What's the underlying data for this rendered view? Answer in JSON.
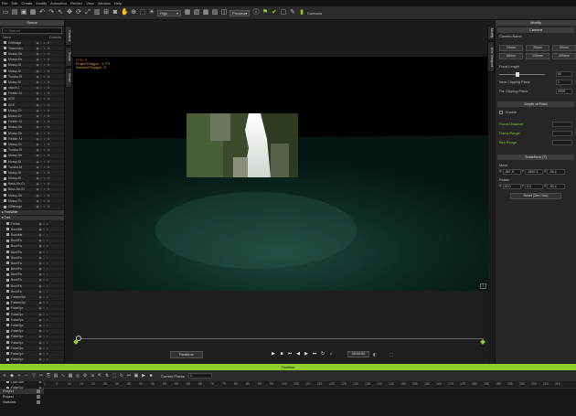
{
  "menu": [
    "File",
    "Edit",
    "Create",
    "Modify",
    "Animation",
    "Render",
    "View",
    "Window",
    "Help"
  ],
  "toolbar": {
    "quality": "High",
    "preview": "Preview",
    "contours": "Contours"
  },
  "scene": {
    "title": "Scene",
    "search_placeholder": "Search",
    "col_name": "Name",
    "col_controls": "Controls",
    "objects": [
      "Cliffmage",
      "Towermsh",
      "Mossy-Str",
      "Mossy-Str",
      "Mossy-St",
      "Mossy-St",
      "Tundra-St",
      "Mossy-St",
      "vaccin 1",
      "Fieldbr-St",
      "AGE",
      "AGE",
      "Mossy-Gr",
      "Mossy-Gr",
      "Fieldbr-St",
      "Mossy-Str",
      "Mossy-Str",
      "Fieldbr-St",
      "Mossy-Gr",
      "Tundra-St",
      "Mossy-Str",
      "Mossy-St",
      "Tundra-St",
      "Mossy-St",
      "Mossy-St",
      "Bass-Str-Gr",
      "Bass-Str-Gr",
      "Mossy-Str",
      "Mossy-Gr",
      "Cliffimage"
    ],
    "group1": "PostWrite",
    "group2": "Tree",
    "tree_items": [
      "Fieldw",
      "BushMe",
      "BushMe",
      "BushFa",
      "BushFa",
      "BushFa",
      "BushFa",
      "BushFa",
      "BushFa",
      "BushFa",
      "BushFa",
      "BushFa",
      "BushFa",
      "FalsemSpi",
      "FalsemSpi",
      "FalseSpr",
      "FalseSpr",
      "FalseSpr",
      "FalseSpr",
      "FalseSpr",
      "FalseSpr",
      "FalseSpr",
      "FalseSpr",
      "FalseSpr",
      "FalseSpr",
      "FalseSpr",
      "FalseSpr",
      "LowClum",
      "LowClum",
      "FalseSpr",
      "FalseSpr",
      "FalseSpr"
    ]
  },
  "side_tabs": [
    "Content",
    "Scene",
    "Visual"
  ],
  "right_tabs": [
    "Modify",
    "Mini Viewport"
  ],
  "viewport": {
    "fps_line": "FPS : 9",
    "polygon_line": "Project Polygon : 3,773",
    "selected_line": "Selected Polygon : 0"
  },
  "playback": {
    "realtime": "Realtime",
    "time": "00:00:00"
  },
  "modify": {
    "title": "Modify",
    "camera_header": "Camera",
    "camera_name_label": "Camera Name",
    "lens_buttons": [
      "24mm",
      "35mm",
      "50mm",
      "85mm",
      "105mm",
      "200mm"
    ],
    "focal_label": "Focal Length",
    "focal_value": "50",
    "near_label": "Near Clipping Plane",
    "near_value": "1",
    "far_label": "Far Clipping Plane",
    "far_value": "9999",
    "dof_header": "Depth of Field",
    "enable_label": "Enable",
    "dof_rows": [
      "Focus Distance",
      "Focus Range",
      "Blur Range"
    ],
    "transform_header": "Transform (T)",
    "move_label": "Move",
    "move_values": [
      "-587.9",
      "-1850.3",
      "-96.4"
    ],
    "rotate_label": "Rotate",
    "rotate_values": [
      "90.0",
      "0.0",
      "-90.4"
    ],
    "axes": [
      "X",
      "Y",
      "Z"
    ],
    "reset_label": "Reset (Zero Out)"
  },
  "timeline": {
    "title": "Timeline",
    "current_frame_label": "Current Frame",
    "current_frame_value": "1",
    "ruler_ticks": [
      "1",
      "5",
      "10",
      "15",
      "20",
      "25",
      "30",
      "35",
      "40",
      "45",
      "50",
      "55",
      "60",
      "65",
      "70",
      "75",
      "80",
      "85",
      "90",
      "95",
      "100",
      "105",
      "110",
      "115",
      "120",
      "125",
      "130",
      "135",
      "140",
      "145",
      "150",
      "155",
      "160",
      "165",
      "170",
      "175",
      "180",
      "185",
      "190",
      "195",
      "200",
      "205",
      "210",
      "215"
    ],
    "tracks": [
      "Project",
      "Project",
      "Switcher"
    ]
  },
  "colors": {
    "accent": "#8fcf2c",
    "hud_text": "#e8a03c",
    "water": "#0b2a24"
  }
}
